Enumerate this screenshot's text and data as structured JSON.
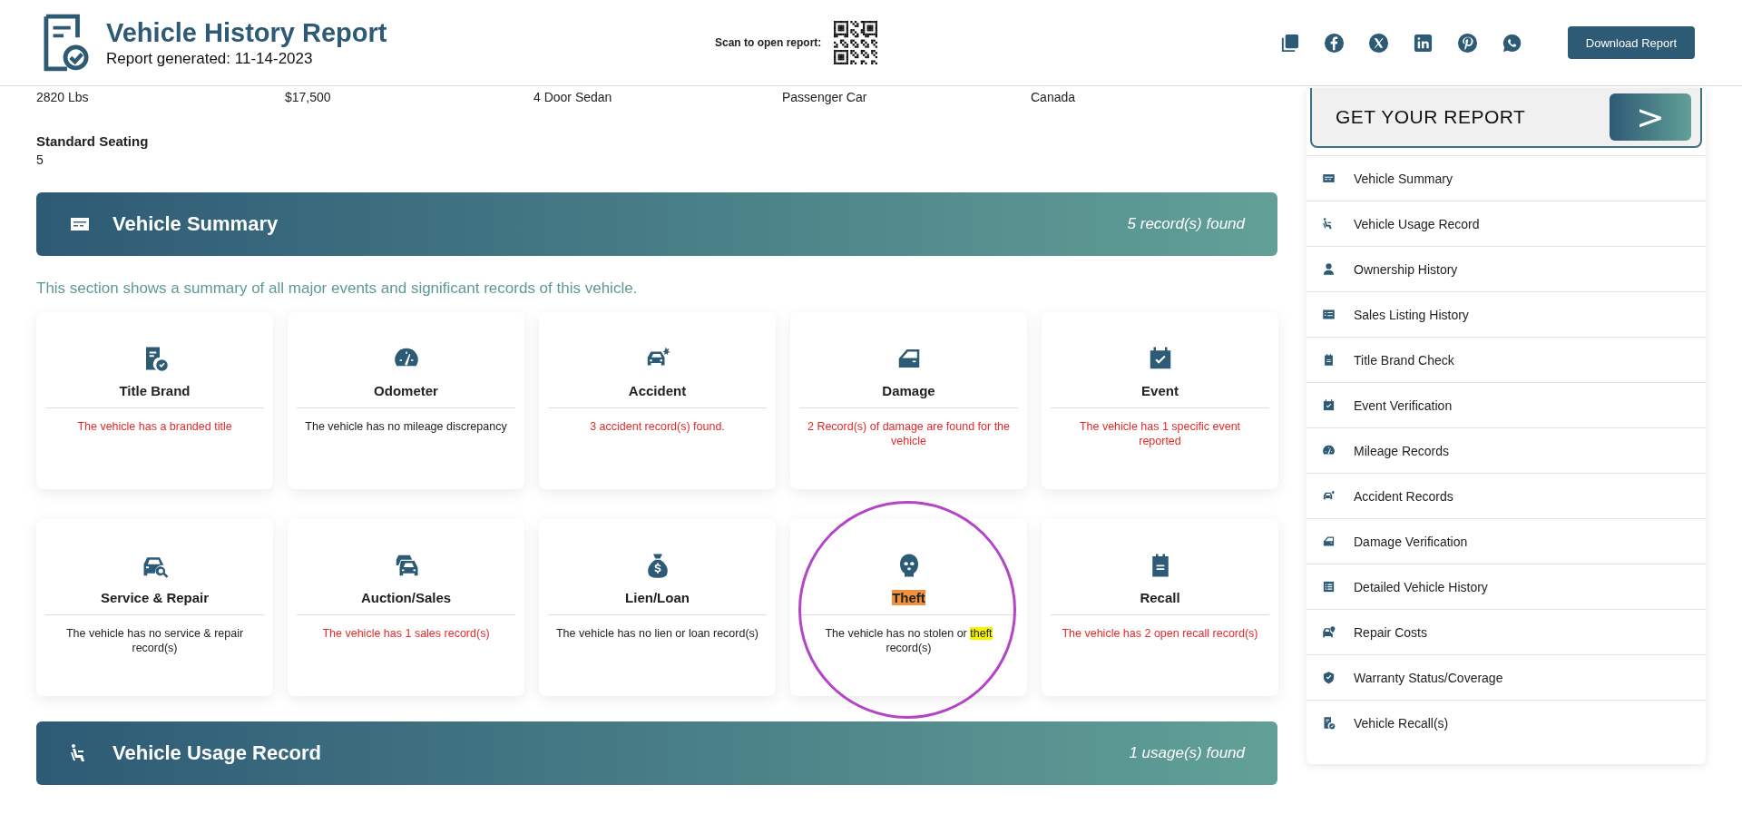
{
  "header": {
    "title": "Vehicle History Report",
    "subtitle": "Report generated: 11-14-2023",
    "qr_label": "Scan to open report:",
    "download_button": "Download Report"
  },
  "specs": [
    "2820 Lbs",
    "$17,500",
    "4 Door Sedan",
    "Passenger Car",
    "Canada"
  ],
  "seating": {
    "label": "Standard Seating",
    "value": "5"
  },
  "summary_banner": {
    "title": "Vehicle Summary",
    "count": "5 record(s) found"
  },
  "summary_intro": "This section shows a summary of all major events and significant records of this vehicle.",
  "cards": [
    {
      "title": "Title Brand",
      "alert": true,
      "circled": false,
      "title_highlight": false,
      "description": [
        {
          "text": "The vehicle has a branded title",
          "highlight": false
        }
      ]
    },
    {
      "title": "Odometer",
      "alert": false,
      "circled": false,
      "title_highlight": false,
      "description": [
        {
          "text": "The vehicle has no mileage discrepancy",
          "highlight": false
        }
      ]
    },
    {
      "title": "Accident",
      "alert": true,
      "circled": false,
      "title_highlight": false,
      "description": [
        {
          "text": "3 accident record(s) found.",
          "highlight": false
        }
      ]
    },
    {
      "title": "Damage",
      "alert": true,
      "circled": false,
      "title_highlight": false,
      "description": [
        {
          "text": "2 Record(s) of damage are found for the vehicle",
          "highlight": false
        }
      ]
    },
    {
      "title": "Event",
      "alert": true,
      "circled": false,
      "title_highlight": false,
      "description": [
        {
          "text": "The vehicle has 1 specific event reported",
          "highlight": false
        }
      ]
    },
    {
      "title": "Service & Repair",
      "alert": false,
      "circled": false,
      "title_highlight": false,
      "description": [
        {
          "text": "The vehicle has no service & repair record(s)",
          "highlight": false
        }
      ]
    },
    {
      "title": "Auction/Sales",
      "alert": true,
      "circled": false,
      "title_highlight": false,
      "description": [
        {
          "text": "The vehicle has 1 sales record(s)",
          "highlight": false
        }
      ]
    },
    {
      "title": "Lien/Loan",
      "alert": false,
      "circled": false,
      "title_highlight": false,
      "description": [
        {
          "text": "The vehicle has no lien or loan record(s)",
          "highlight": false
        }
      ]
    },
    {
      "title": "Theft",
      "alert": false,
      "circled": true,
      "title_highlight": true,
      "description": [
        {
          "text": "The vehicle has no stolen or ",
          "highlight": false
        },
        {
          "text": "theft",
          "highlight": true
        },
        {
          "text": " record(s)",
          "highlight": false
        }
      ]
    },
    {
      "title": "Recall",
      "alert": true,
      "circled": false,
      "title_highlight": false,
      "description": [
        {
          "text": "The vehicle has 2 open recall record(s)",
          "highlight": false
        }
      ]
    }
  ],
  "usage_banner": {
    "title": "Vehicle Usage Record",
    "count": "1 usage(s) found"
  },
  "sidebar": {
    "cta": "GET YOUR REPORT",
    "cta_arrow": ">",
    "items": [
      "Vehicle Summary",
      "Vehicle Usage Record",
      "Ownership History",
      "Sales Listing History",
      "Title Brand Check",
      "Event Verification",
      "Mileage Records",
      "Accident Records",
      "Damage Verification",
      "Detailed Vehicle History",
      "Repair Costs",
      "Warranty Status/Coverage",
      "Vehicle Recall(s)"
    ]
  }
}
